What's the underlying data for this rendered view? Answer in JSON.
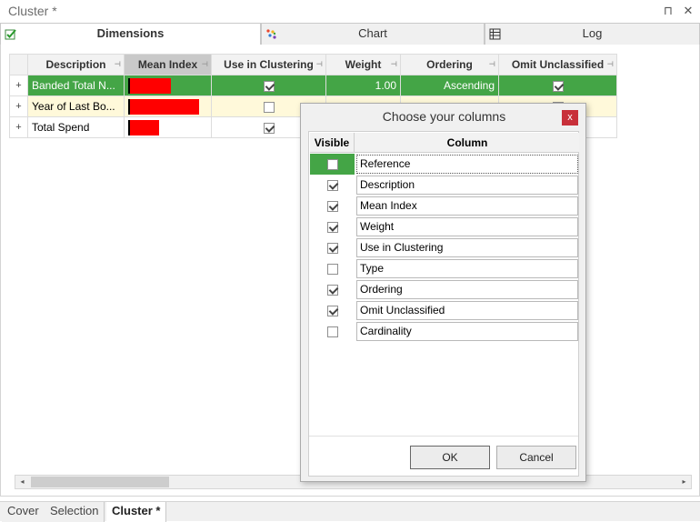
{
  "window": {
    "title": "Cluster *",
    "pin_glyph": "⊓",
    "close_glyph": "✕"
  },
  "top_tabs": [
    {
      "label": "Dimensions",
      "icon": "check-list-icon",
      "active": true
    },
    {
      "label": "Chart",
      "icon": "scatter-chart-icon",
      "active": false
    },
    {
      "label": "Log",
      "icon": "log-table-icon",
      "active": false
    }
  ],
  "grid": {
    "columns": [
      "Description",
      "Mean Index",
      "Use in Clustering",
      "Weight",
      "Ordering",
      "Omit Unclassified"
    ],
    "rows": [
      {
        "expander": "+",
        "description": "Banded Total N...",
        "mean_index": 0.6,
        "use": true,
        "weight": "1.00",
        "ordering": "Ascending",
        "omit": true
      },
      {
        "expander": "+",
        "description": "Year of Last Bo...",
        "mean_index": 1.0,
        "use": false,
        "weight": "",
        "ordering": "",
        "omit": false
      },
      {
        "expander": "+",
        "description": "Total Spend",
        "mean_index": 0.44,
        "use": true,
        "weight": "",
        "ordering": "",
        "omit": false
      }
    ]
  },
  "scroll": {
    "left_arrow": "◂",
    "right_arrow": "▸"
  },
  "bottom_tabs": [
    {
      "label": "Cover",
      "active": false
    },
    {
      "label": "Selection",
      "active": false
    },
    {
      "label": "Cluster *",
      "active": true
    }
  ],
  "dialog": {
    "title": "Choose your columns",
    "close_glyph": "x",
    "header_visible": "Visible",
    "header_column": "Column",
    "items": [
      {
        "name": "Reference",
        "visible": false,
        "selected": true
      },
      {
        "name": "Description",
        "visible": true,
        "selected": false
      },
      {
        "name": "Mean Index",
        "visible": true,
        "selected": false
      },
      {
        "name": "Weight",
        "visible": true,
        "selected": false
      },
      {
        "name": "Use in Clustering",
        "visible": true,
        "selected": false
      },
      {
        "name": "Type",
        "visible": false,
        "selected": false
      },
      {
        "name": "Ordering",
        "visible": true,
        "selected": false
      },
      {
        "name": "Omit Unclassified",
        "visible": true,
        "selected": false
      },
      {
        "name": "Cardinality",
        "visible": false,
        "selected": false
      }
    ],
    "ok_label": "OK",
    "cancel_label": "Cancel"
  },
  "colors": {
    "accent_green": "#44a546",
    "highlight_yellow": "#fff9da",
    "bar_red": "#ff0000",
    "dialog_close_red": "#c8303a"
  }
}
